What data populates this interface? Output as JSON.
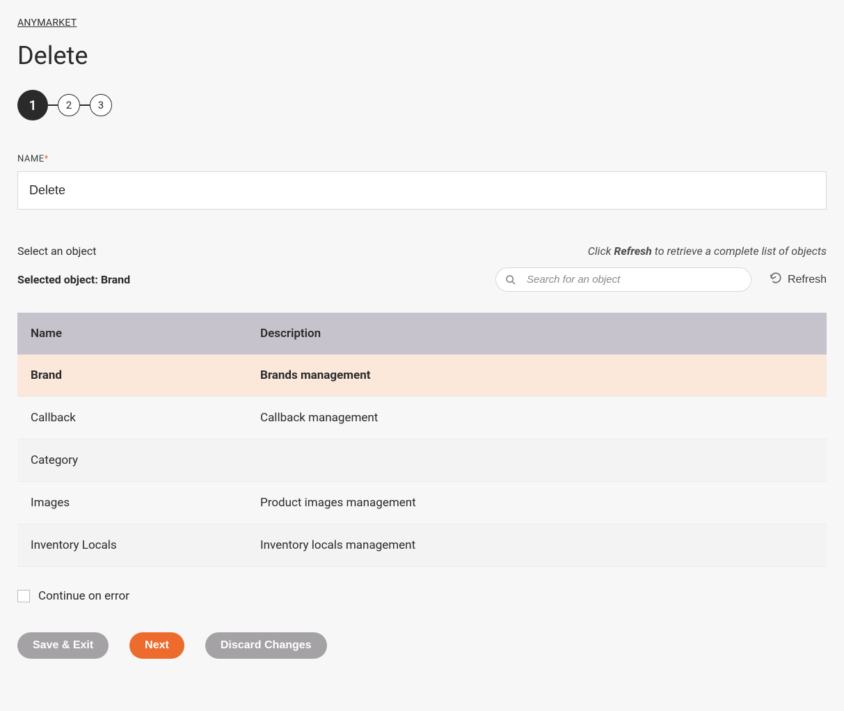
{
  "breadcrumb": "ANYMARKET",
  "page_title": "Delete",
  "stepper": {
    "steps": [
      "1",
      "2",
      "3"
    ],
    "active_index": 0
  },
  "name_field": {
    "label": "NAME",
    "required_mark": "*",
    "value": "Delete"
  },
  "object_section": {
    "label": "Select an object",
    "hint_prefix": "Click ",
    "hint_strong": "Refresh",
    "hint_suffix": " to retrieve a complete list of objects",
    "selected_label_prefix": "Selected object: ",
    "selected_object": "Brand",
    "search_placeholder": "Search for an object",
    "refresh_label": "Refresh"
  },
  "table": {
    "headers": [
      "Name",
      "Description"
    ],
    "rows": [
      {
        "name": "Brand",
        "description": "Brands management",
        "selected": true
      },
      {
        "name": "Callback",
        "description": "Callback management",
        "selected": false
      },
      {
        "name": "Category",
        "description": "",
        "selected": false
      },
      {
        "name": "Images",
        "description": "Product images management",
        "selected": false
      },
      {
        "name": "Inventory Locals",
        "description": "Inventory locals management",
        "selected": false
      }
    ]
  },
  "continue_on_error_label": "Continue on error",
  "buttons": {
    "save_exit": "Save & Exit",
    "next": "Next",
    "discard": "Discard Changes"
  }
}
